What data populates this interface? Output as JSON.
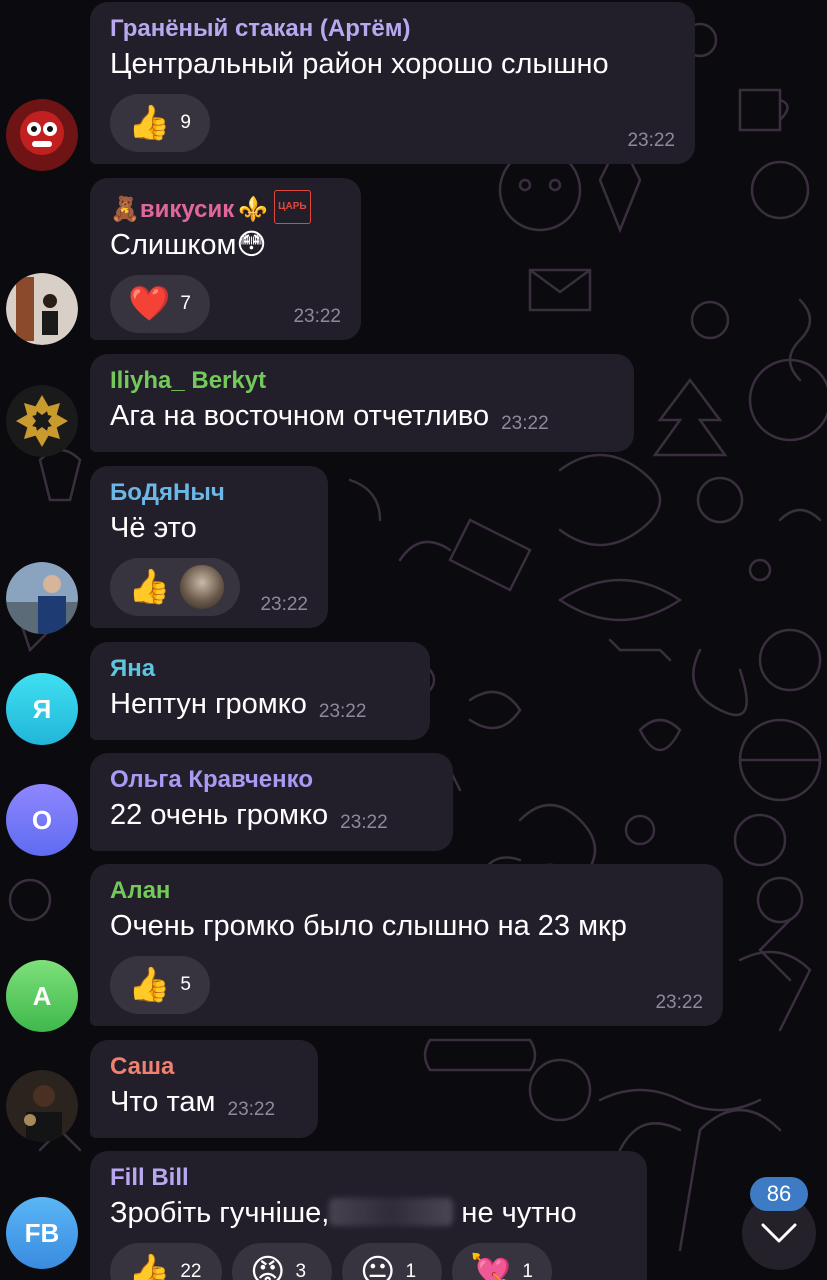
{
  "colors": {
    "bubble": "#221f2b",
    "reaction_pill": "#38343f",
    "time": "#8e8a99",
    "unread_badge": "#3d7cc4"
  },
  "messages": [
    {
      "sender": "Гранёный стакан (Артём)",
      "sender_color": "#b9a8f0",
      "text": "Центральный район хорошо слышно",
      "time": "23:22",
      "reactions": [
        {
          "emoji": "👍",
          "count": "9"
        }
      ]
    },
    {
      "sender": "викусик",
      "sender_prefix_emoji": "🧸",
      "sender_suffix_emoji": "⚜️",
      "sender_tag": "ЦАРЬ",
      "sender_color": "#e1679a",
      "text": "Слишком😳",
      "time": "23:22",
      "reactions": [
        {
          "emoji": "❤️",
          "count": "7"
        }
      ]
    },
    {
      "sender": "Iliyha_ Berkyt",
      "sender_color": "#74c95b",
      "text": "Ага на восточном отчетливо",
      "time": "23:22",
      "reactions": []
    },
    {
      "sender": "БоДяНыч",
      "sender_color": "#6bb8e8",
      "text": "Чё это",
      "time": "23:22",
      "reactions": [
        {
          "emoji": "👍",
          "count": ""
        }
      ]
    },
    {
      "sender": "Яна",
      "sender_color": "#5fc4de",
      "text": "Нептун громко",
      "time": "23:22",
      "reactions": [],
      "avatar_letter": "Я"
    },
    {
      "sender": "Ольга Кравченко",
      "sender_color": "#a99af2",
      "text": "22 очень громко",
      "time": "23:22",
      "reactions": [],
      "avatar_letter": "О"
    },
    {
      "sender": "Алан",
      "sender_color": "#74c95b",
      "text": "Очень громко было слышно на 23 мкр",
      "time": "23:22",
      "reactions": [
        {
          "emoji": "👍",
          "count": "5"
        }
      ],
      "avatar_letter": "А"
    },
    {
      "sender": "Саша",
      "sender_color": "#f0806f",
      "text": "Что там",
      "time": "23:22",
      "reactions": []
    },
    {
      "sender": "Fill Bill",
      "sender_color": "#b9a8f0",
      "text_before": "Зробіть гучніше,",
      "text_after": " не чутно",
      "avatar_letter": "FB",
      "reactions": [
        {
          "emoji": "👍",
          "count": "22"
        },
        {
          "emoji": "😡",
          "count": "3"
        },
        {
          "emoji": "😐",
          "count": "1"
        },
        {
          "emoji": "💘",
          "count": "1"
        }
      ]
    }
  ],
  "scroll": {
    "unread_count": "86"
  }
}
